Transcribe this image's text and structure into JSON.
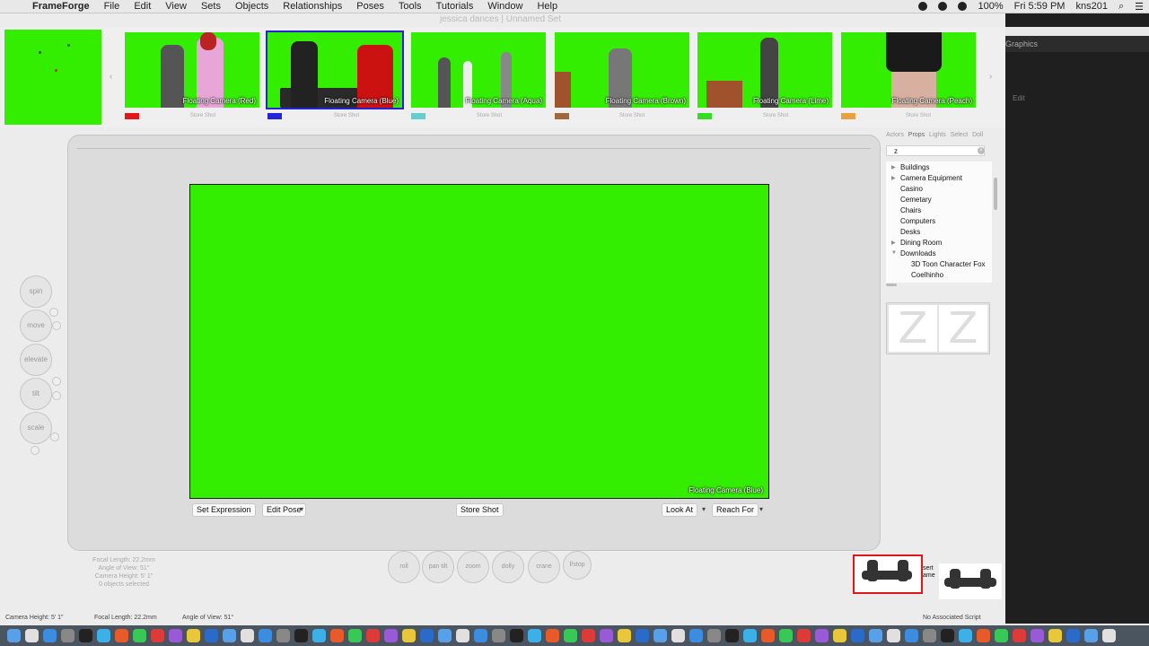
{
  "menubar": {
    "app_name": "FrameForge",
    "items": [
      "File",
      "Edit",
      "View",
      "Sets",
      "Objects",
      "Relationships",
      "Poses",
      "Tools",
      "Tutorials",
      "Window",
      "Help"
    ],
    "battery": "100%",
    "clock": "Fri 5:59 PM",
    "user": "kns201"
  },
  "window_title": "jessica dances | Unnamed Set",
  "other_app": {
    "header": "Graphics",
    "label": "Edit"
  },
  "shots": [
    {
      "caption": "Floating Camera (Red)",
      "store": "Store Shot",
      "color": "#e01818",
      "selected": false
    },
    {
      "caption": "Floating Camera (Blue)",
      "store": "Store Shot",
      "color": "#2323d8",
      "selected": true
    },
    {
      "caption": "Floating Camera (Aqua)",
      "store": "Store Shot",
      "color": "#66cccc",
      "selected": false
    },
    {
      "caption": "Floating Camera (Brown)",
      "store": "Store Shot",
      "color": "#a0673a",
      "selected": false
    },
    {
      "caption": "Floating Camera (Lime)",
      "store": "Store Shot",
      "color": "#33dd22",
      "selected": false
    },
    {
      "caption": "Floating Camera (Peach)",
      "store": "Store Shot",
      "color": "#e8a040",
      "selected": false
    }
  ],
  "viewport": {
    "caption": "Floating Camera (Blue)",
    "bg_color": "#33ee00"
  },
  "viewport_buttons": {
    "set_expression": "Set Expression",
    "edit_pose": "Edit Pose",
    "store_shot": "Store Shot",
    "look_at": "Look At",
    "reach_for": "Reach For"
  },
  "left_controls": {
    "spin": "spin",
    "move": "move",
    "elevate": "elevate",
    "tilt": "tilt",
    "scale": "scale"
  },
  "camera_controls": {
    "roll": "roll",
    "pan_tilt": "pan tilt",
    "zoom": "zoom",
    "dolly": "dolly",
    "crane": "crane",
    "fstop": "f/stop"
  },
  "camera_info": {
    "focal_length": "Focal Length: 22.2mm",
    "angle_of_view": "Angle of View: 51°",
    "camera_height": "Camera Height: 5' 1\"",
    "objects_selected": "0 objects selected"
  },
  "right_panel": {
    "tabs": [
      "Actors",
      "Props",
      "Lights",
      "Select",
      "Doll"
    ],
    "active_tab": "Props",
    "search_value": "z",
    "tree": [
      {
        "label": "Buildings",
        "expandable": true,
        "indent": 0
      },
      {
        "label": "Camera Equipment",
        "expandable": true,
        "indent": 0
      },
      {
        "label": "Casino",
        "expandable": false,
        "indent": 0
      },
      {
        "label": "Cemetary",
        "expandable": false,
        "indent": 0
      },
      {
        "label": "Chairs",
        "expandable": false,
        "indent": 0
      },
      {
        "label": "Computers",
        "expandable": false,
        "indent": 0
      },
      {
        "label": "Desks",
        "expandable": false,
        "indent": 0
      },
      {
        "label": "Dining Room",
        "expandable": true,
        "indent": 0
      },
      {
        "label": "Downloads",
        "expandable": true,
        "expanded": true,
        "indent": 0
      },
      {
        "label": "3D Toon Character Fox",
        "expandable": false,
        "indent": 1
      },
      {
        "label": "Coelhinho",
        "expandable": false,
        "indent": 1
      }
    ],
    "preview_glyph": "Z"
  },
  "insert_frame": "sert\name",
  "statusbar": {
    "camera_height": "Camera Height: 5' 1\"",
    "focal_length": "Focal Length: 22.2mm",
    "angle_of_view": "Angle of View: 51°",
    "script": "No Associated Script"
  }
}
